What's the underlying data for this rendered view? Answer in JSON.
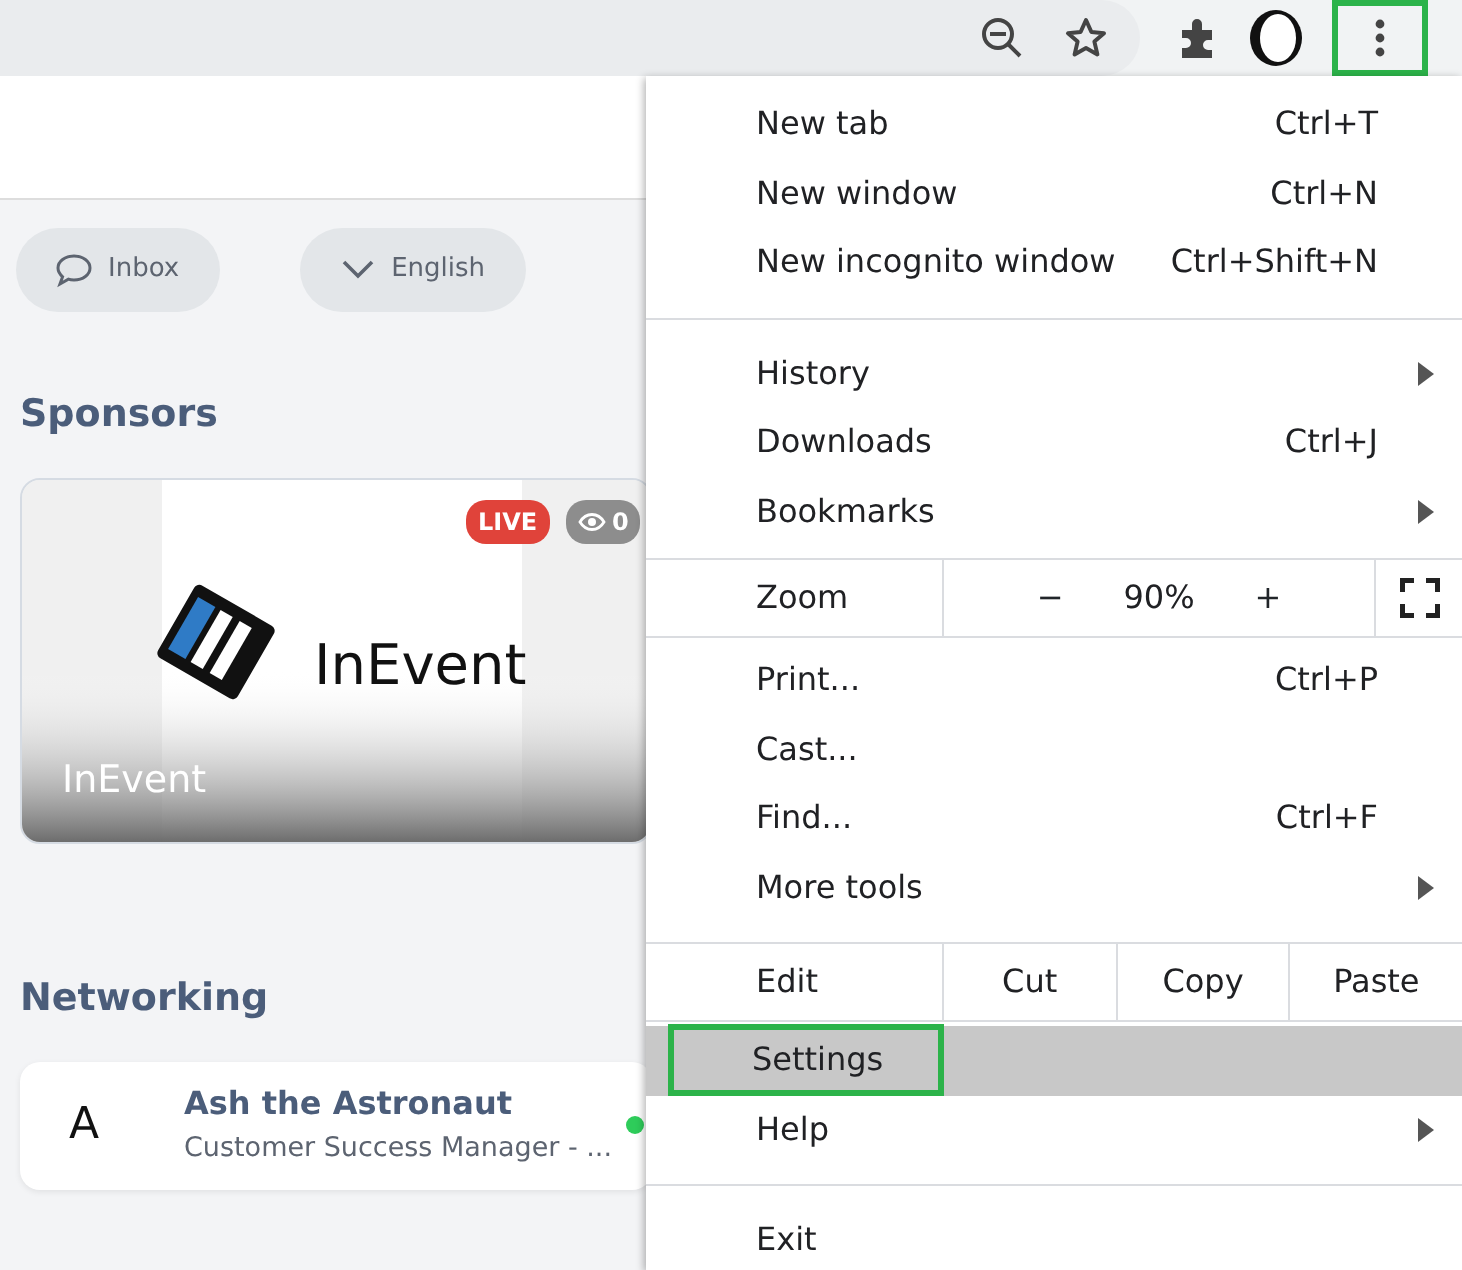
{
  "toolbar": {
    "menu_button": {
      "highlighted": true
    }
  },
  "page": {
    "buttons": [
      {
        "label": "Inbox"
      },
      {
        "label": "English"
      }
    ],
    "sponsors": {
      "title": "Sponsors",
      "card": {
        "name": "InEvent",
        "logo_text": "InEvent",
        "live": "LIVE",
        "viewers": "0"
      }
    },
    "networking": {
      "title": "Networking",
      "person": {
        "initial": "A",
        "name": "Ash the Astronaut",
        "role": "Customer Success Manager - ...",
        "online": true
      }
    }
  },
  "menu": {
    "items": [
      {
        "kind": "item",
        "label": "New tab",
        "shortcut": "Ctrl+T",
        "submenu": false,
        "selected": false
      },
      {
        "kind": "item",
        "label": "New window",
        "shortcut": "Ctrl+N",
        "submenu": false,
        "selected": false
      },
      {
        "kind": "item",
        "label": "New incognito window",
        "shortcut": "Ctrl+Shift+N",
        "submenu": false,
        "selected": false
      },
      {
        "kind": "separator"
      },
      {
        "kind": "item",
        "label": "History",
        "submenu": true,
        "selected": false
      },
      {
        "kind": "item",
        "label": "Downloads",
        "shortcut": "Ctrl+J",
        "submenu": false,
        "selected": false
      },
      {
        "kind": "item",
        "label": "Bookmarks",
        "submenu": true,
        "selected": false
      },
      {
        "kind": "zoom",
        "label": "Zoom",
        "minus": "−",
        "value": "90%",
        "plus": "+"
      },
      {
        "kind": "item",
        "label": "Print...",
        "shortcut": "Ctrl+P",
        "submenu": false,
        "selected": false
      },
      {
        "kind": "item",
        "label": "Cast...",
        "submenu": false,
        "selected": false
      },
      {
        "kind": "item",
        "label": "Find...",
        "shortcut": "Ctrl+F",
        "submenu": false,
        "selected": false
      },
      {
        "kind": "item",
        "label": "More tools",
        "submenu": true,
        "selected": false
      },
      {
        "kind": "edit",
        "label": "Edit",
        "actions": [
          "Cut",
          "Copy",
          "Paste"
        ]
      },
      {
        "kind": "item",
        "label": "Settings",
        "submenu": false,
        "selected": true,
        "highlighted": true
      },
      {
        "kind": "item",
        "label": "Help",
        "submenu": true,
        "selected": false
      },
      {
        "kind": "separator"
      },
      {
        "kind": "item",
        "label": "Exit",
        "submenu": false,
        "selected": false
      }
    ]
  }
}
